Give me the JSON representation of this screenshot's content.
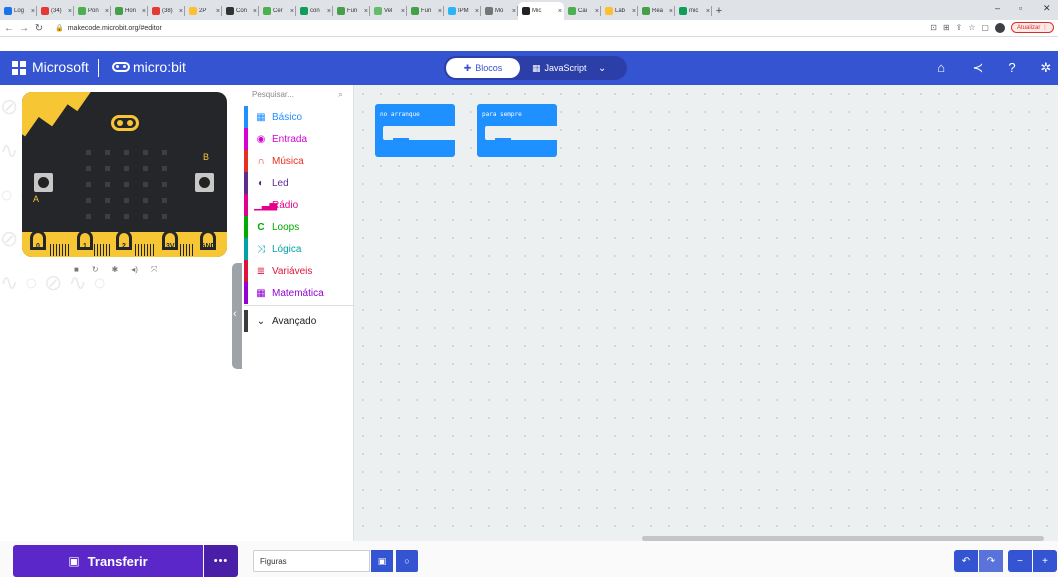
{
  "browser": {
    "tabs": [
      {
        "title": "Log",
        "color": "#1a73e8"
      },
      {
        "title": "(34)",
        "color": "#e53935"
      },
      {
        "title": "Pon",
        "color": "#4caf50"
      },
      {
        "title": "Hon",
        "color": "#43a047"
      },
      {
        "title": "(38)",
        "color": "#e53935"
      },
      {
        "title": "2P",
        "color": "#fbc02d"
      },
      {
        "title": "Con",
        "color": "#333333"
      },
      {
        "title": "Cer",
        "color": "#4caf50"
      },
      {
        "title": "con",
        "color": "#0f9d58"
      },
      {
        "title": "Fun",
        "color": "#43a047"
      },
      {
        "title": "Vel",
        "color": "#66bb6a"
      },
      {
        "title": "Fun",
        "color": "#43a047"
      },
      {
        "title": "IPM",
        "color": "#29b6f6"
      },
      {
        "title": "Mo",
        "color": "#757575"
      },
      {
        "title": "Mic",
        "color": "#222222",
        "active": true
      },
      {
        "title": "Cai",
        "color": "#4caf50"
      },
      {
        "title": "Lab",
        "color": "#fbc02d"
      },
      {
        "title": "Rea",
        "color": "#43a047"
      },
      {
        "title": "mic",
        "color": "#0f9d58"
      }
    ],
    "new_tab": "+",
    "url": "makecode.microbit.org/#editor",
    "update_label": "Atualizar"
  },
  "header": {
    "microsoft_label": "Microsoft",
    "microbit_label": "micro:bit",
    "blocks_label": "Blocos",
    "javascript_label": "JavaScript"
  },
  "board": {
    "label_a": "A",
    "label_b": "B",
    "pins": [
      "0",
      "1",
      "2",
      "3V",
      "GND"
    ]
  },
  "toolbox": {
    "search_placeholder": "Pesquisar...",
    "categories": [
      {
        "label": "Básico",
        "color": "#1e90ff",
        "icon": "grid-icon"
      },
      {
        "label": "Entrada",
        "color": "#d400d4",
        "icon": "target-icon"
      },
      {
        "label": "Música",
        "color": "#e63022",
        "icon": "headphones-icon"
      },
      {
        "label": "Led",
        "color": "#5c2d91",
        "icon": "toggle-icon"
      },
      {
        "label": "Rádio",
        "color": "#e3008c",
        "icon": "signal-icon"
      },
      {
        "label": "Loops",
        "color": "#00aa00",
        "icon": "loop-icon"
      },
      {
        "label": "Lógica",
        "color": "#00a4a6",
        "icon": "shuffle-icon"
      },
      {
        "label": "Variáveis",
        "color": "#dc143c",
        "icon": "list-icon"
      },
      {
        "label": "Matemática",
        "color": "#9400d3",
        "icon": "calculator-icon"
      }
    ],
    "advanced_label": "Avançado"
  },
  "workspace": {
    "blocks": [
      {
        "label": "no arranque",
        "color": "#1e90ff"
      },
      {
        "label": "para sempre",
        "color": "#1e90ff"
      }
    ]
  },
  "footer": {
    "transfer_label": "Transferir",
    "more_label": "•••",
    "project_name": "Figuras"
  }
}
